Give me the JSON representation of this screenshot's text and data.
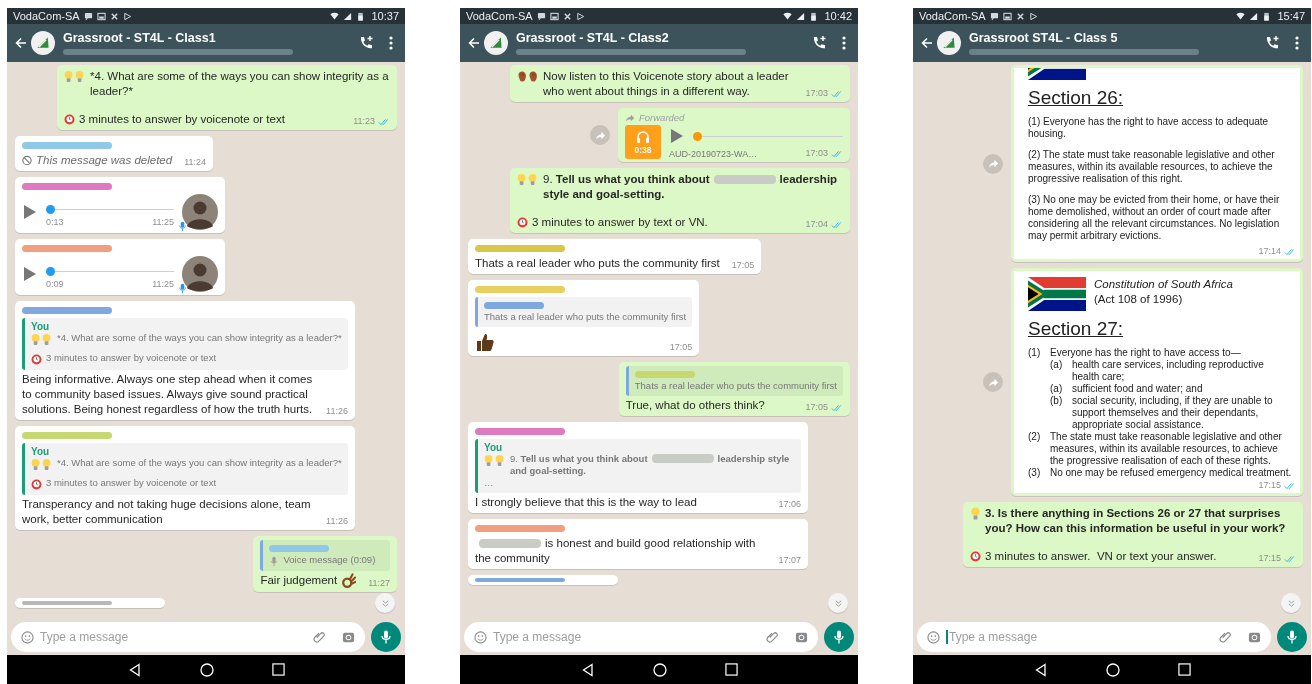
{
  "phones": [
    {
      "status": {
        "carrier": "VodaCom-SA",
        "time": "10:37"
      },
      "header": {
        "title": "Grassroot - ST4L - Class1"
      },
      "messages": [
        {
          "kind": "text",
          "outgoing": true,
          "forward": false,
          "paras": [
            {
              "kind": "question",
              "text": "*4. What are some of the ways you can show integrity as a leader?*"
            },
            {
              "kind": "timer",
              "text": "3 minutes to answer by voicenote or text"
            }
          ],
          "time": "11:23",
          "read": true
        },
        {
          "kind": "text",
          "outgoing": false,
          "forward": false,
          "paras": [
            {
              "kind": "deleted",
              "text": "This message was deleted"
            }
          ],
          "time": "11:24"
        },
        {
          "kind": "voice",
          "outgoing": false,
          "forward": false,
          "duration": "0:13",
          "time": "11:25",
          "level": 0
        },
        {
          "kind": "voice",
          "outgoing": false,
          "forward": false,
          "duration": "0:09",
          "time": "11:25",
          "level": 0
        },
        {
          "kind": "text",
          "outgoing": false,
          "forward": false,
          "quote": {
            "author": "You",
            "paras": [
              {
                "kind": "question",
                "text": "*4. What are some of the ways you can show integrity as a leader?*"
              },
              {
                "kind": "timer",
                "text": "3 minutes to answer by voicenote or text"
              }
            ]
          },
          "paras": [
            {
              "kind": "text",
              "text": "Being informative. Always one step ahead when it comes to community based issues. Always give sound practical solutions. Being honest regardless of how the truth hurts."
            }
          ],
          "time": "11:26"
        },
        {
          "kind": "text",
          "outgoing": false,
          "forward": false,
          "quote": {
            "author": "You",
            "paras": [
              {
                "kind": "question",
                "text": "*4. What are some of the ways you can show integrity as a leader?*"
              },
              {
                "kind": "timer",
                "text": "3 minutes to answer by voicenote or text"
              }
            ]
          },
          "paras": [
            {
              "kind": "text",
              "text": "Transperancy and not taking huge decisions alone, team work, better communication"
            }
          ],
          "time": "11:26"
        },
        {
          "kind": "text",
          "outgoing": true,
          "forward": false,
          "quote": {
            "paras": [
              {
                "kind": "voiceref",
                "text": "Voice message (0:09)"
              }
            ]
          },
          "paras": [
            {
              "kind": "approval",
              "text": "Fair judgement"
            }
          ],
          "time": "11:27"
        },
        {
          "kind": "peek",
          "outgoing": false,
          "forward": false
        }
      ],
      "input": {
        "placeholder": "Type a message",
        "focused": false
      }
    },
    {
      "status": {
        "carrier": "VodaCom-SA",
        "time": "10:42"
      },
      "header": {
        "title": "Grassroot - ST4L - Class2"
      },
      "messages": [
        {
          "kind": "text",
          "outgoing": true,
          "forward": false,
          "paras": [
            {
              "kind": "story",
              "text": "Now listen to this Voicenote story about a leader who went about things in a different way."
            }
          ],
          "time": "17:03",
          "read": true
        },
        {
          "kind": "audio",
          "outgoing": true,
          "forward": true,
          "forwarded": "Forwarded",
          "duration": "0:38",
          "file": "AUD-20190723-WA…",
          "time": "17:03",
          "read": true,
          "level": 0
        },
        {
          "kind": "text",
          "outgoing": true,
          "forward": false,
          "paras": [
            {
              "kind": "question",
              "segments": [
                {
                  "kind": "text",
                  "text": "9. ",
                  "bold": false
                },
                {
                  "kind": "text",
                  "text": "Tell us what you think about",
                  "bold": true
                },
                {
                  "kind": "redacted"
                },
                {
                  "kind": "text",
                  "text": "leadership style and goal-setting.",
                  "bold": true
                }
              ]
            },
            {
              "kind": "timer",
              "text": "3 minutes to answer by text or VN."
            }
          ],
          "time": "17:04",
          "read": true
        },
        {
          "kind": "text",
          "outgoing": false,
          "forward": false,
          "paras": [
            {
              "kind": "text",
              "text": "Thats a real leader who puts the community first"
            }
          ],
          "time": "17:05"
        },
        {
          "kind": "text",
          "outgoing": false,
          "forward": false,
          "quote": {
            "paras": [
              {
                "kind": "text",
                "text": "Thats a real leader who puts the community first"
              }
            ]
          },
          "paras": [
            {
              "kind": "reaction"
            }
          ],
          "time": "17:05"
        },
        {
          "kind": "text",
          "outgoing": true,
          "forward": false,
          "quote": {
            "paras": [
              {
                "kind": "text",
                "text": "Thats a real leader who puts the community first"
              }
            ]
          },
          "paras": [
            {
              "kind": "text",
              "text": "True, what do others think?"
            }
          ],
          "time": "17:05",
          "read": true
        },
        {
          "kind": "text",
          "outgoing": false,
          "forward": false,
          "quote": {
            "author": "You",
            "paras": [
              {
                "kind": "question",
                "segments": [
                  {
                    "kind": "text",
                    "text": "9. ",
                    "bold": false
                  },
                  {
                    "kind": "text",
                    "text": "Tell us what you think about",
                    "bold": true
                  },
                  {
                    "kind": "redacted"
                  },
                  {
                    "kind": "text",
                    "text": "leadership style and goal-setting.",
                    "bold": true
                  }
                ]
              },
              {
                "kind": "text",
                "text": "…"
              }
            ]
          },
          "paras": [
            {
              "kind": "text",
              "text": "I strongly believe that this is the way to lead"
            }
          ],
          "time": "17:06"
        },
        {
          "kind": "text",
          "outgoing": false,
          "forward": false,
          "paras": [
            {
              "kind": "text",
              "segments": [
                {
                  "kind": "redacted"
                },
                {
                  "kind": "text",
                  "text": "is honest and build good relationship with the community",
                  "bold": false
                }
              ]
            }
          ],
          "time": "17:07"
        },
        {
          "kind": "peek",
          "outgoing": false,
          "forward": false
        }
      ],
      "input": {
        "placeholder": "Type a message",
        "focused": false
      }
    },
    {
      "status": {
        "carrier": "VodaCom-SA",
        "time": "15:47"
      },
      "header": {
        "title": "Grassroot ST4L - Class 5"
      },
      "messages": [
        {
          "kind": "document",
          "outgoing": true,
          "forward": true,
          "heading": "Section 26:",
          "paras": [
            "(1) Everyone has the right to have access to adequate housing.",
            "(2) The state must take reasonable legislative and other measures, within its available resources, to achieve the progressive realisation of this right.",
            "(3) No one may be evicted from their home, or have their home demolished, without an order of court made after considering all the relevant circumstances. No legislation may permit arbitrary evictions."
          ],
          "time": "17:14",
          "read": true
        },
        {
          "kind": "document",
          "outgoing": true,
          "forward": true,
          "caption": [
            "Constitution of South Africa",
            "(Act 108 of 1996)"
          ],
          "heading": "Section 27:",
          "items": [
            {
              "label": "(1)",
              "text": "Everyone has the right to have access to—",
              "children": [
                {
                  "label": "(a)",
                  "text": "health care services, including reproductive health care;"
                },
                {
                  "label": "(a)",
                  "text": "sufficient food and water; and"
                },
                {
                  "label": "(b)",
                  "text": "social security, including, if they are unable to support themselves and their dependants, appropriate social assistance."
                }
              ]
            },
            {
              "label": "(2)",
              "text": "The state must take reasonable legislative and other measures, within its available resources, to achieve the progressive realisation of each of these rights."
            },
            {
              "label": "(3)",
              "text": "No one may be refused emergency medical treatment."
            }
          ],
          "time": "17:15",
          "read": true
        },
        {
          "kind": "text",
          "outgoing": true,
          "forward": false,
          "paras": [
            {
              "kind": "prompt",
              "text": "3. Is there anything in Sections 26 or 27 that surprises you? How can this information be useful in your work?",
              "bold": true
            },
            {
              "kind": "timer",
              "text": "3 minutes to answer.  VN or text your answer."
            }
          ],
          "time": "17:15",
          "read": true
        }
      ],
      "input": {
        "placeholder": "Type a message",
        "focused": true
      }
    }
  ]
}
